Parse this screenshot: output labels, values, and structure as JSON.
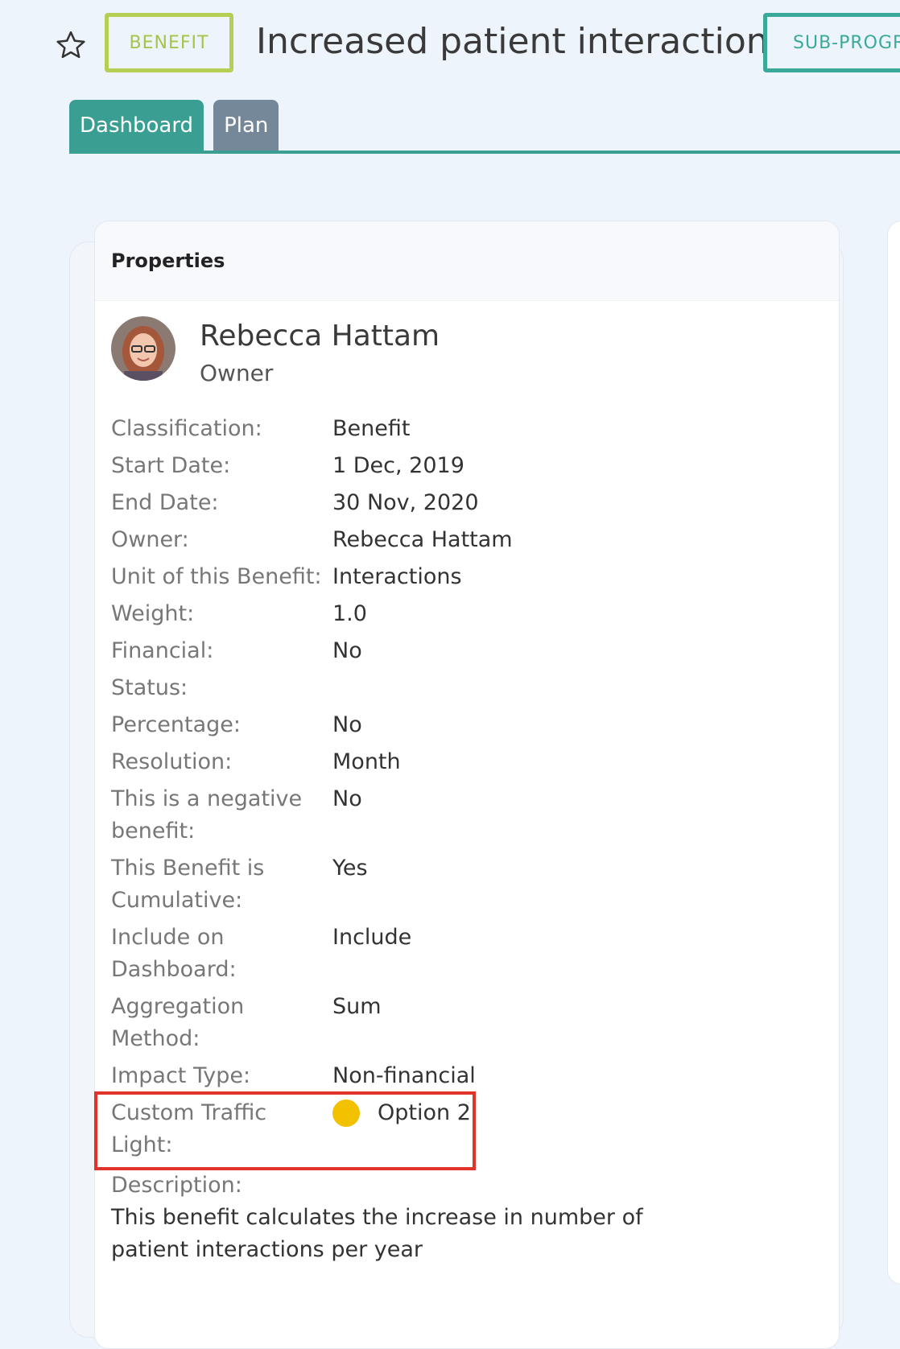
{
  "header": {
    "badge_type": "BENEFIT",
    "title": "Increased patient interactions",
    "badge_program": "SUB-PROGR"
  },
  "tabs": [
    {
      "label": "Dashboard",
      "active": true
    },
    {
      "label": "Plan",
      "active": false
    }
  ],
  "properties_card": {
    "title": "Properties",
    "owner": {
      "name": "Rebecca Hattam",
      "role": "Owner"
    },
    "fields": [
      {
        "label": "Classification:",
        "value": "Benefit"
      },
      {
        "label": "Start Date:",
        "value": "1 Dec, 2019"
      },
      {
        "label": "End Date:",
        "value": "30 Nov, 2020"
      },
      {
        "label": "Owner:",
        "value": "Rebecca Hattam"
      },
      {
        "label": "Unit of this Benefit:",
        "value": "Interactions"
      },
      {
        "label": "Weight:",
        "value": "1.0"
      },
      {
        "label": "Financial:",
        "value": "No"
      },
      {
        "label": "Status:",
        "value": ""
      },
      {
        "label": "Percentage:",
        "value": "No"
      },
      {
        "label": "Resolution:",
        "value": "Month"
      },
      {
        "label": "This is a negative benefit:",
        "value": "No"
      },
      {
        "label": "This Benefit is Cumulative:",
        "value": "Yes"
      },
      {
        "label": "Include on Dashboard:",
        "value": "Include"
      },
      {
        "label": "Aggregation Method:",
        "value": "Sum"
      },
      {
        "label": "Impact Type:",
        "value": "Non-financial"
      },
      {
        "label": "Custom Traffic Light:",
        "value": "Option 2",
        "indicator_color": "#f2c100"
      }
    ],
    "description_label": "Description:",
    "description": "This benefit calculates the increase in number of patient interactions per year"
  },
  "colors": {
    "accent": "#3a9f92",
    "benefit_badge": "#b5cf55",
    "highlight": "#e0332a"
  }
}
